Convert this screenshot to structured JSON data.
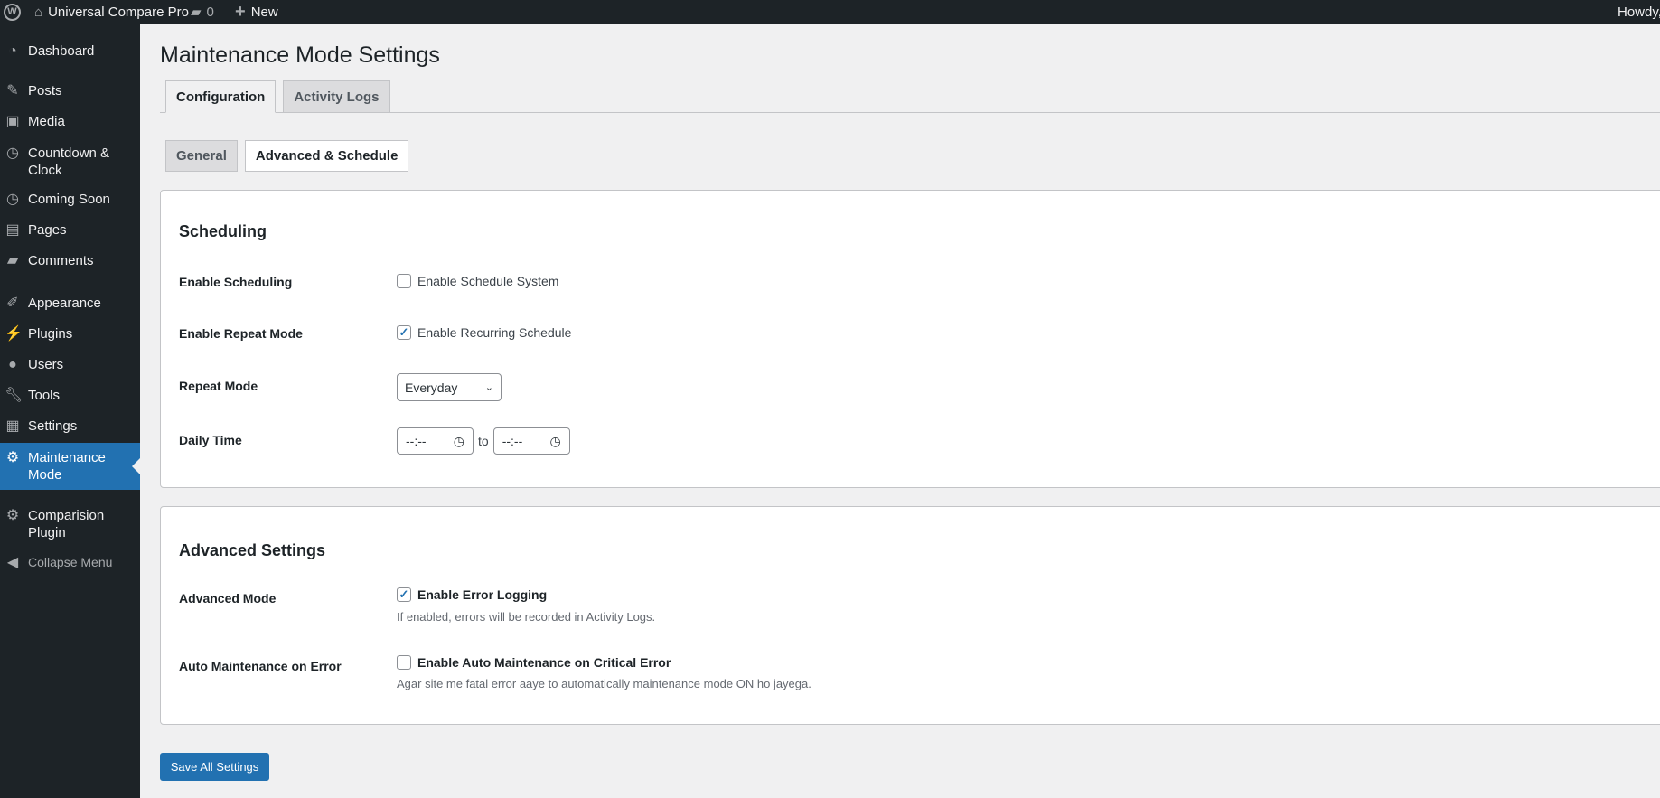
{
  "adminbar": {
    "site": "Universal Compare Pro",
    "comments": "0",
    "new": "New",
    "howdy": "Howdy,"
  },
  "sidebar": {
    "items": [
      {
        "label": "Dashboard",
        "icon": "dashboard-icon"
      },
      {
        "label": "Posts",
        "icon": "pin-icon"
      },
      {
        "label": "Media",
        "icon": "media-icon"
      },
      {
        "label": "Countdown & Clock",
        "icon": "clock-icon"
      },
      {
        "label": "Coming Soon",
        "icon": "clock-icon"
      },
      {
        "label": "Pages",
        "icon": "pages-icon"
      },
      {
        "label": "Comments",
        "icon": "comment-icon"
      },
      {
        "label": "Appearance",
        "icon": "brush-icon"
      },
      {
        "label": "Plugins",
        "icon": "plugin-icon"
      },
      {
        "label": "Users",
        "icon": "user-icon"
      },
      {
        "label": "Tools",
        "icon": "wrench-icon"
      },
      {
        "label": "Settings",
        "icon": "settings-icon"
      },
      {
        "label": "Maintenance Mode",
        "icon": "gear-icon"
      },
      {
        "label": "Comparision Plugin",
        "icon": "gear-icon"
      },
      {
        "label": "Collapse Menu",
        "icon": "collapse-icon"
      }
    ]
  },
  "page": {
    "title": "Maintenance Mode Settings",
    "tabs": [
      "Configuration",
      "Activity Logs"
    ],
    "subtabs": [
      "General",
      "Advanced & Schedule"
    ]
  },
  "scheduling": {
    "heading": "Scheduling",
    "enable_label": "Enable Scheduling",
    "enable_text": "Enable Schedule System",
    "enable_checked": false,
    "repeat_label": "Enable Repeat Mode",
    "repeat_text": "Enable Recurring Schedule",
    "repeat_checked": true,
    "mode_label": "Repeat Mode",
    "mode_value": "Everyday",
    "time_label": "Daily Time",
    "time_from": "--:--",
    "time_sep": "to",
    "time_to": "--:--"
  },
  "advanced": {
    "heading": "Advanced Settings",
    "mode_label": "Advanced Mode",
    "mode_text": "Enable Error Logging",
    "mode_checked": true,
    "mode_desc": "If enabled, errors will be recorded in Activity Logs.",
    "auto_label": "Auto Maintenance on Error",
    "auto_text": "Enable Auto Maintenance on Critical Error",
    "auto_checked": false,
    "auto_desc": "Agar site me fatal error aaye to automatically maintenance mode ON ho jayega."
  },
  "save_label": "Save All Settings"
}
